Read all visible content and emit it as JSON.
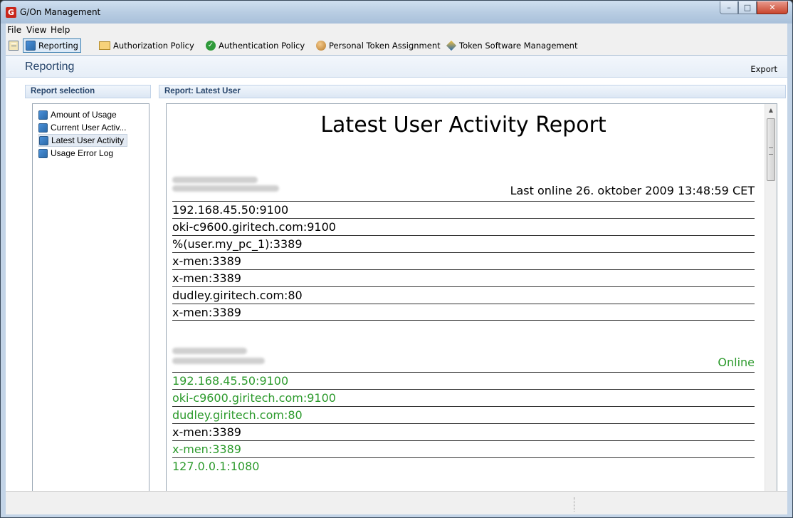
{
  "window": {
    "title": "G/On Management",
    "app_icon_letter": "G"
  },
  "menu": {
    "file": "File",
    "view": "View",
    "help": "Help"
  },
  "toolbar": {
    "reporting": "Reporting",
    "authorization": "Authorization Policy",
    "authentication": "Authentication Policy",
    "personal_token": "Personal Token Assignment",
    "token_software": "Token Software Management"
  },
  "section": {
    "title": "Reporting",
    "export": "Export"
  },
  "report_selection": {
    "header": "Report selection",
    "items": [
      {
        "label": "Amount of Usage"
      },
      {
        "label": "Current User Activ..."
      },
      {
        "label": "Latest User Activity"
      },
      {
        "label": "Usage Error Log"
      }
    ],
    "selected_index": 2
  },
  "report": {
    "header": "Report: Latest User",
    "title": "Latest User Activity Report",
    "users": [
      {
        "status": "Last online 26. oktober 2009 13:48:59 CET",
        "entries": [
          {
            "text": "192.168.45.50:9100"
          },
          {
            "text": "oki-c9600.giritech.com:9100"
          },
          {
            "text": "%(user.my_pc_1):3389"
          },
          {
            "text": "x-men:3389"
          },
          {
            "text": "x-men:3389"
          },
          {
            "text": "dudley.giritech.com:80"
          },
          {
            "text": "x-men:3389"
          }
        ]
      },
      {
        "status": "Online",
        "entries": [
          {
            "text": "192.168.45.50:9100"
          },
          {
            "text": "oki-c9600.giritech.com:9100"
          },
          {
            "text": "dudley.giritech.com:80"
          },
          {
            "text": "x-men:3389"
          },
          {
            "text": "x-men:3389"
          },
          {
            "text": "127.0.0.1:1080"
          }
        ]
      }
    ]
  },
  "colors": {
    "online_green": "#2c9a2c",
    "header_blue": "#27456b"
  }
}
